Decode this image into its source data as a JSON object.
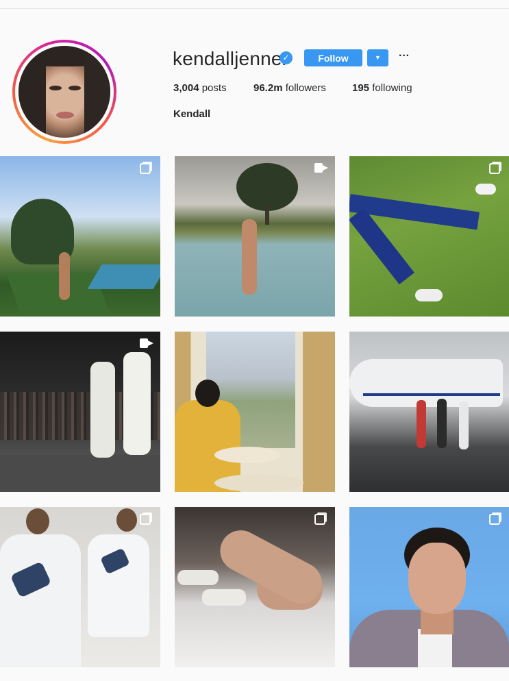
{
  "profile": {
    "username": "kendalljenner",
    "verified_glyph": "✓",
    "follow_label": "Follow",
    "dropdown_glyph": "▼",
    "more_glyph": "···",
    "posts_count": "3,004",
    "posts_label": "posts",
    "followers_count": "96.2m",
    "followers_label": "followers",
    "following_count": "195",
    "following_label": "following",
    "full_name": "Kendall",
    "accent_color": "#3897f0"
  },
  "posts": [
    {
      "icon": "multiple-photos-icon"
    },
    {
      "icon": "video-icon"
    },
    {
      "icon": "multiple-photos-icon"
    },
    {
      "icon": "video-icon"
    },
    {
      "icon": "none"
    },
    {
      "icon": "none"
    },
    {
      "icon": "multiple-photos-icon"
    },
    {
      "icon": "multiple-photos-icon"
    },
    {
      "icon": "multiple-photos-icon"
    }
  ]
}
